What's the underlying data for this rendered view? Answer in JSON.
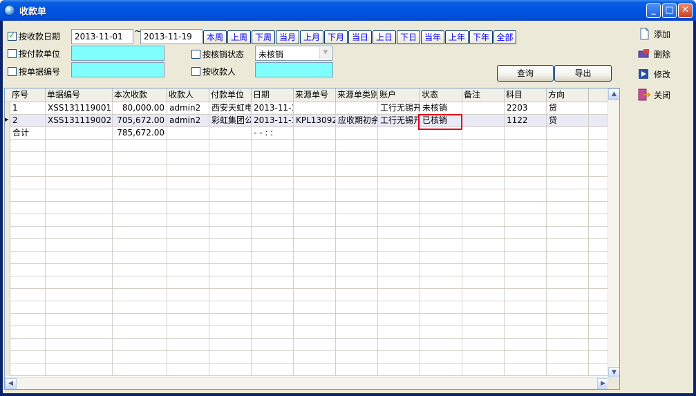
{
  "window": {
    "title": "收款单"
  },
  "filters": {
    "date_check": {
      "label": "按收款日期",
      "checked": true
    },
    "payer_check": {
      "label": "按付款单位",
      "checked": false
    },
    "docno_check": {
      "label": "按单据编号",
      "checked": false
    },
    "status_check": {
      "label": "按核销状态",
      "checked": false
    },
    "receiver_check": {
      "label": "按收款人",
      "checked": false
    },
    "date_from": "2013-11-01",
    "date_to": "2013-11-19",
    "tilde": "~",
    "status_value": "未核销",
    "payer_value": "",
    "docno_value": "",
    "receiver_value": ""
  },
  "quick_buttons": [
    "本周",
    "上周",
    "下周",
    "当月",
    "上月",
    "下月",
    "当日",
    "上日",
    "下日",
    "当年",
    "上年",
    "下年",
    "全部"
  ],
  "actions": {
    "query": "查询",
    "export": "导出"
  },
  "sidebar": {
    "add": "添加",
    "delete": "删除",
    "modify": "修改",
    "close": "关闭"
  },
  "grid": {
    "columns": [
      "序号",
      "单据编号",
      "本次收款",
      "收款人",
      "付款单位",
      "日期",
      "来源单号",
      "来源单类别",
      "账户",
      "状态",
      "备注",
      "科目",
      "方向"
    ],
    "rows": [
      [
        "1",
        "XSS131119001",
        "80,000.00",
        "admin2",
        "西安天虹电",
        "2013-11-1",
        "",
        "",
        "工行无锡开",
        "未核销",
        "",
        "2203",
        "贷"
      ],
      [
        "2",
        "XSS131119002",
        "705,672.00",
        "admin2",
        "彩虹集团公",
        "2013-11-1",
        "KPL13092",
        "应收期初余",
        "工行无锡开",
        "已核销",
        "",
        "1122",
        "贷"
      ],
      [
        "合计",
        "",
        "785,672.00",
        "",
        "",
        "- -   : :",
        "",
        "",
        "",
        "",
        "",
        "",
        ""
      ]
    ],
    "selected_row": 1
  },
  "colors": {
    "title_blue": "#0054e3",
    "cyan_field": "#80ffff",
    "highlight_red": "#e0001a",
    "link_blue": "#0000ff"
  }
}
